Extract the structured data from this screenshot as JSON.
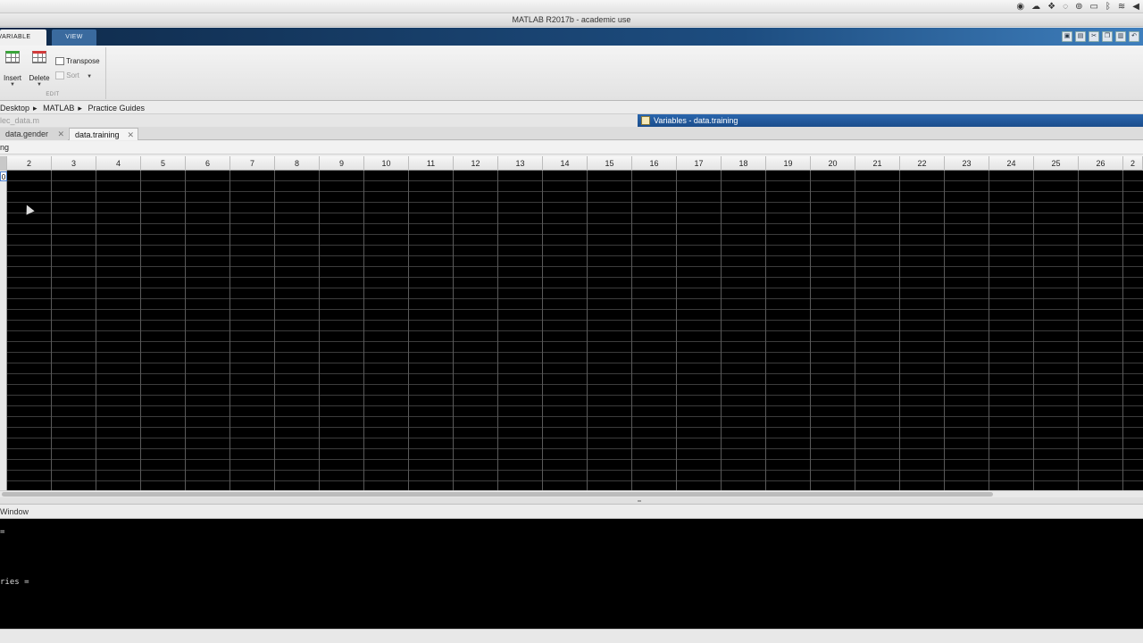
{
  "menubar": {
    "tray_icons": [
      "record-icon",
      "cloud-icon",
      "dropbox-icon",
      "sync-icon",
      "creative-cloud-icon",
      "monitor-icon",
      "bluetooth-icon",
      "wifi-icon",
      "volume-icon"
    ]
  },
  "window": {
    "title": "MATLAB R2017b - academic use"
  },
  "toolstrip": {
    "tabs": [
      {
        "label": "VARIABLE",
        "active": true
      },
      {
        "label": "VIEW",
        "active": false
      }
    ],
    "groups": [
      {
        "label": "EDIT"
      }
    ],
    "buttons": {
      "insert": "Insert",
      "delete": "Delete",
      "transpose": "Transpose",
      "sort": "Sort"
    }
  },
  "address": {
    "crumbs": [
      "Desktop",
      "MATLAB",
      "Practice Guides"
    ]
  },
  "editor": {
    "file_hint": "lec_data.m"
  },
  "variables_panel": {
    "title": "Variables - data.training",
    "tabs": [
      {
        "label": "data.gender",
        "active": false
      },
      {
        "label": "data.training",
        "active": true
      }
    ],
    "variable_name": "ng",
    "columns": [
      "2",
      "3",
      "4",
      "5",
      "6",
      "7",
      "8",
      "9",
      "10",
      "11",
      "12",
      "13",
      "14",
      "15",
      "16",
      "17",
      "18",
      "19",
      "20",
      "21",
      "22",
      "23",
      "24",
      "25",
      "26",
      "2"
    ],
    "selected_cell": "0",
    "hscroll_fraction": 0.87
  },
  "command_window": {
    "title": "Window",
    "lines": [
      "=",
      "ries ="
    ]
  },
  "colors": {
    "toolstrip_dark": "#0f2a4a",
    "toolstrip_light": "#3f7fbd",
    "var_title_bg": "#1b4d8c",
    "grid_bg": "#000000"
  }
}
